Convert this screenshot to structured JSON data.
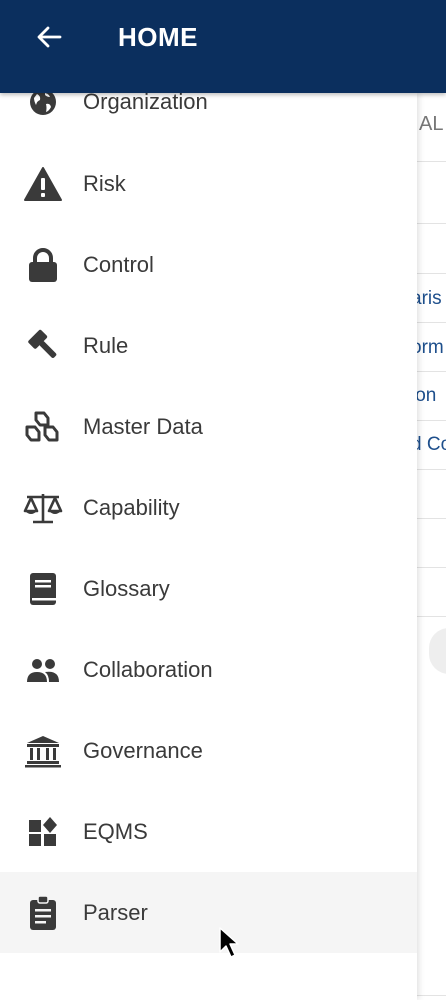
{
  "header": {
    "title": "HOME",
    "back_icon": "arrow-left-icon"
  },
  "drawer": {
    "items": [
      {
        "label": "Organization",
        "icon": "globe-icon"
      },
      {
        "label": "Risk",
        "icon": "warning-icon"
      },
      {
        "label": "Control",
        "icon": "lock-icon"
      },
      {
        "label": "Rule",
        "icon": "gavel-icon"
      },
      {
        "label": "Master Data",
        "icon": "cubes-icon"
      },
      {
        "label": "Capability",
        "icon": "balance-scale-icon"
      },
      {
        "label": "Glossary",
        "icon": "book-icon"
      },
      {
        "label": "Collaboration",
        "icon": "people-icon"
      },
      {
        "label": "Governance",
        "icon": "institution-icon"
      },
      {
        "label": "EQMS",
        "icon": "widgets-icon"
      },
      {
        "label": "Parser",
        "icon": "clipboard-icon",
        "active": true
      }
    ]
  },
  "background": {
    "tab_fragment": "AL",
    "rows": [
      "aris",
      "orm",
      "ion",
      "d Co"
    ]
  },
  "colors": {
    "header": "#0b2f5e",
    "link": "#1e4f8c",
    "active_bg": "#f5f5f5"
  }
}
